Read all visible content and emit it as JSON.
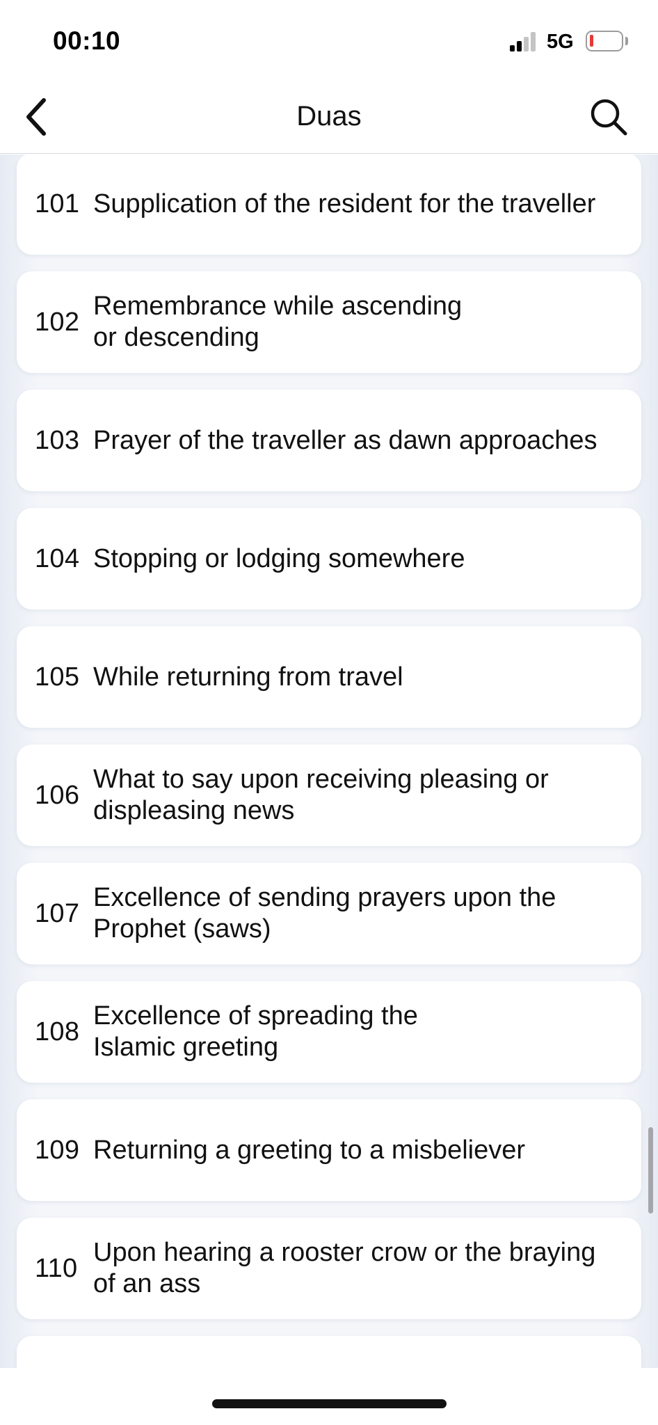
{
  "status_bar": {
    "time": "00:10",
    "network": "5G",
    "battery_color": "#e53935"
  },
  "nav": {
    "title": "Duas",
    "back_icon": "chevron-left-icon",
    "search_icon": "search-icon"
  },
  "items": [
    {
      "number": "101",
      "title": "Supplication of the resident for the traveller"
    },
    {
      "number": "102",
      "title": "Remembrance while ascending",
      "title_line2": "or descending"
    },
    {
      "number": "103",
      "title": "Prayer of the traveller as dawn approaches"
    },
    {
      "number": "104",
      "title": "Stopping or lodging somewhere"
    },
    {
      "number": "105",
      "title": "While returning from travel"
    },
    {
      "number": "106",
      "title": "What to say upon receiving pleasing or",
      "title_line2": "displeasing news"
    },
    {
      "number": "107",
      "title": "Excellence of sending prayers upon the",
      "title_line2": "Prophet (saws)"
    },
    {
      "number": "108",
      "title": "Excellence of spreading the",
      "title_line2": "Islamic greeting"
    },
    {
      "number": "109",
      "title": "Returning a greeting to a misbeliever"
    },
    {
      "number": "110",
      "title": "Upon hearing a rooster crow or the braying",
      "title_line2": "of an ass"
    },
    {
      "number": "",
      "title": ""
    }
  ]
}
